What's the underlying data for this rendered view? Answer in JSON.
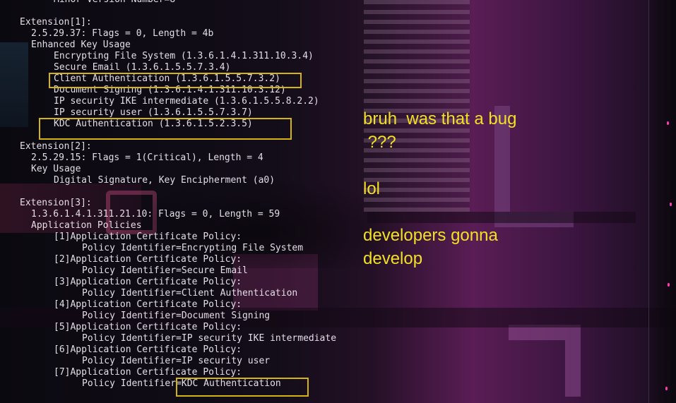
{
  "terminal": {
    "lines": [
      "Minor Version Number=8",
      "Extension[1]:",
      "2.5.29.37: Flags = 0, Length = 4b",
      "Enhanced Key Usage",
      "Encrypting File System (1.3.6.1.4.1.311.10.3.4)",
      "Secure Email (1.3.6.1.5.5.7.3.4)",
      "Client Authentication (1.3.6.1.5.5.7.3.2)",
      "Document Signing (1.3.6.1.4.1.311.10.3.12)",
      "IP security IKE intermediate (1.3.6.1.5.5.8.2.2)",
      "IP security user (1.3.6.1.5.5.7.3.7)",
      "KDC Authentication (1.3.6.1.5.2.3.5)",
      "Extension[2]:",
      "2.5.29.15: Flags = 1(Critical), Length = 4",
      "Key Usage",
      "Digital Signature, Key Encipherment (a0)",
      "Extension[3]:",
      "1.3.6.1.4.1.311.21.10: Flags = 0, Length = 59",
      "Application Policies",
      "[1]Application Certificate Policy:",
      "Policy Identifier=Encrypting File System",
      "[2]Application Certificate Policy:",
      "Policy Identifier=Secure Email",
      "[3]Application Certificate Policy:",
      "Policy Identifier=Client Authentication",
      "[4]Application Certificate Policy:",
      "Policy Identifier=Document Signing",
      "[5]Application Certificate Policy:",
      "Policy Identifier=IP security IKE intermediate",
      "[6]Application Certificate Policy:",
      "Policy Identifier=IP security user",
      "[7]Application Certificate Policy:",
      "Policy Identifier=KDC Authentication"
    ]
  },
  "chat": {
    "line1": "bruh  was that a bug",
    "line2": " ???",
    "line3": "lol",
    "line4": "developers gonna",
    "line5": "develop"
  },
  "colors": {
    "terminal_text": "#e4dde6",
    "highlight_box": "#d4b414",
    "chat_text": "#f1e024",
    "accent_pink": "#ff3ab0"
  }
}
